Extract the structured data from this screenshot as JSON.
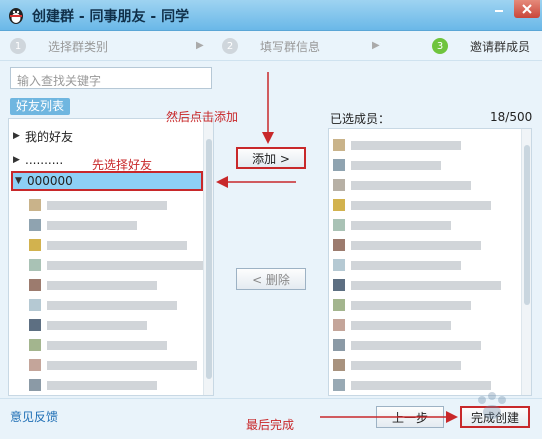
{
  "window": {
    "title": "创建群 - 同事朋友 - 同学",
    "logo_icon": "qq-penguin-icon",
    "minimize_icon": "minimize-icon",
    "close_icon": "close-icon"
  },
  "steps": [
    {
      "number": "1",
      "label": "选择群类别",
      "active": false
    },
    {
      "number": "2",
      "label": "填写群信息",
      "active": false
    },
    {
      "number": "3",
      "label": "邀请群成员",
      "active": true
    }
  ],
  "search": {
    "placeholder": "输入查找关键字"
  },
  "friend_list": {
    "tab_label": "好友列表",
    "groups": [
      {
        "label": "我的好友",
        "expanded": false
      },
      {
        "label": "..........",
        "expanded": false
      },
      {
        "label": "000000",
        "expanded": true
      }
    ]
  },
  "actions": {
    "add_label": "添加 >",
    "remove_label": "< 删除",
    "prev_label": "上一步",
    "finish_label": "完成创建"
  },
  "selected_members": {
    "label": "已选成员：",
    "count": "18/500"
  },
  "footer": {
    "feedback_label": "意见反馈"
  },
  "annotations": {
    "then_add": "然后点击添加",
    "first_select": "先选择好友",
    "finally_finish": "最后完成"
  },
  "colors": {
    "annotation": "#c8282a",
    "selected_row": "#8dd0f5",
    "active_step": "#6fc43d"
  }
}
